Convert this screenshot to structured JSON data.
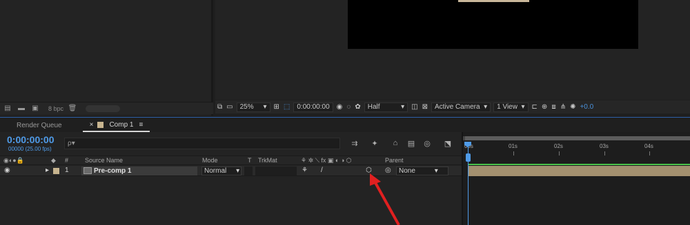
{
  "project": {
    "bpc_label": "8 bpc"
  },
  "viewer": {
    "zoom": "25%",
    "timecode": "0:00:00:00",
    "resolution": "Half",
    "camera": "Active Camera",
    "views": "1 View",
    "exposure": "+0.0"
  },
  "tabs": [
    {
      "label": "Render Queue"
    },
    {
      "label": "Comp 1"
    }
  ],
  "timeline": {
    "timecode": "0:00:00:00",
    "timecode_sub": "00000 (25.00 fps)",
    "search_placeholder": "ρ▾",
    "columns": {
      "hash": "#",
      "source_name": "Source Name",
      "mode": "Mode",
      "t": "T",
      "trkmat": "TrkMat",
      "parent": "Parent"
    },
    "ruler": {
      "labels": [
        "00s",
        "01s",
        "02s",
        "03s",
        "04s"
      ]
    },
    "layer": {
      "number": "1",
      "name": "Pre-comp 1",
      "mode": "Normal",
      "parent": "None"
    }
  },
  "colors": {
    "accent": "#4f9be8",
    "layer_label": "#c7b48f",
    "layer_bar": "#a3906f",
    "arrow": "#e02020"
  }
}
